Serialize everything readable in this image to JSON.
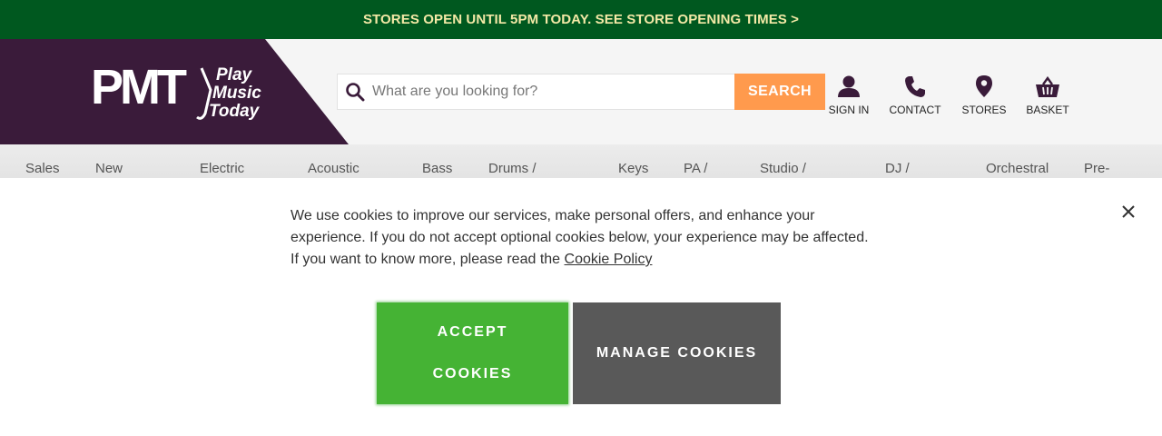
{
  "promo": {
    "text": "STORES OPEN UNTIL 5PM TODAY. SEE STORE OPENING TIMES >"
  },
  "brand": {
    "logo_letters": "PMT",
    "tagline_1": "Play",
    "tagline_2": "Music",
    "tagline_3": "Today",
    "color": "#3a1b3a"
  },
  "search": {
    "placeholder": "What are you looking for?",
    "value": "",
    "button_label": "SEARCH"
  },
  "header_actions": [
    {
      "label": "SIGN IN",
      "icon": "user-icon"
    },
    {
      "label": "CONTACT",
      "icon": "phone-icon"
    },
    {
      "label": "STORES",
      "icon": "map-pin-icon"
    },
    {
      "label": "BASKET",
      "icon": "basket-icon"
    }
  ],
  "nav": [
    "Sales",
    "New",
    "Electric",
    "Acoustic",
    "Bass",
    "Drums /",
    "Keys",
    "PA /",
    "Studio /",
    "DJ /",
    "Orchestral",
    "Pre-"
  ],
  "cookie_banner": {
    "message": "We use cookies to improve our services, make personal offers, and enhance your experience. If you do not accept optional cookies below, your experience may be affected. If you want to know more, please read the",
    "link_text": "Cookie Policy",
    "accept_label": "ACCEPT COOKIES",
    "manage_label": "MANAGE COOKIES"
  },
  "colors": {
    "promo_bg": "#00581f",
    "promo_text": "#f3e9a6",
    "brand_purple": "#3a1b3a",
    "search_button": "#ff9a4d",
    "accept_green": "#45b334",
    "manage_grey": "#595959"
  }
}
